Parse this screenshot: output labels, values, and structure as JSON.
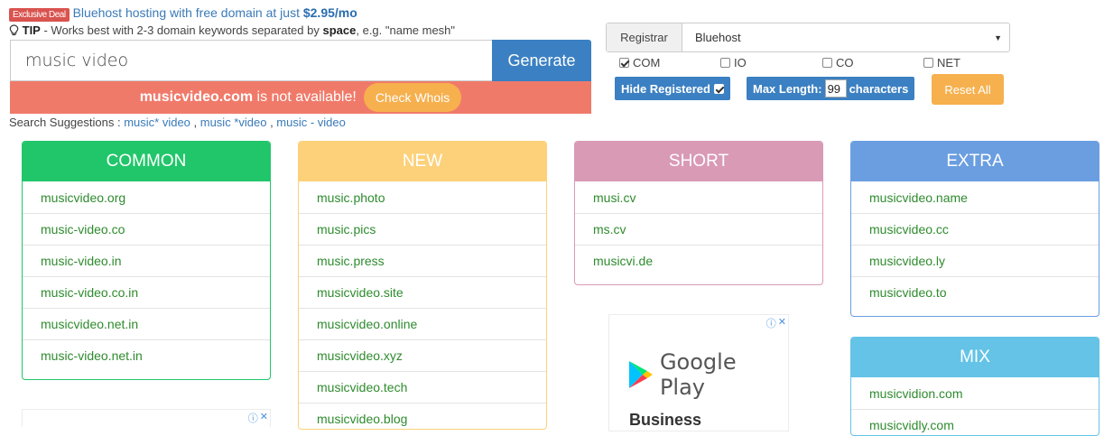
{
  "promo": {
    "badge": "Exclusive Deal",
    "text": "Bluehost hosting with free domain at just ",
    "price": "$2.95/mo"
  },
  "tip": {
    "label": "TIP",
    "text_before": " - Works best with 2-3 domain keywords separated by ",
    "bold": "space",
    "text_after": ", e.g. \"name mesh\""
  },
  "search": {
    "value": "music video",
    "button": "Generate"
  },
  "availability": {
    "domain": "musicvideo.com",
    "message": " is not available!",
    "button": "Check Whois"
  },
  "suggestions": {
    "label": "Search Suggestions : ",
    "items": [
      "music* video",
      "music *video",
      "music - video"
    ]
  },
  "filters": {
    "registrar_label": "Registrar",
    "registrar_value": "Bluehost",
    "tlds": [
      {
        "label": "COM",
        "checked": true
      },
      {
        "label": "IO",
        "checked": false
      },
      {
        "label": "CO",
        "checked": false
      },
      {
        "label": "NET",
        "checked": false
      }
    ],
    "hide_registered": "Hide Registered",
    "max_length_label": "Max Length:",
    "max_length_value": "99",
    "max_length_unit": "characters",
    "reset": "Reset All"
  },
  "cards": {
    "common": {
      "title": "COMMON",
      "items": [
        "musicvideo.org",
        "music-video.co",
        "music-video.in",
        "music-video.co.in",
        "musicvideo.net.in",
        "music-video.net.in"
      ]
    },
    "new": {
      "title": "NEW",
      "items": [
        "music.photo",
        "music.pics",
        "music.press",
        "musicvideo.site",
        "musicvideo.online",
        "musicvideo.xyz",
        "musicvideo.tech",
        "musicvideo.blog"
      ]
    },
    "short": {
      "title": "SHORT",
      "items": [
        "musi.cv",
        "ms.cv",
        "musicvi.de"
      ]
    },
    "extra": {
      "title": "EXTRA",
      "items": [
        "musicvideo.name",
        "musicvideo.cc",
        "musicvideo.ly",
        "musicvideo.to"
      ]
    },
    "mix": {
      "title": "MIX",
      "items": [
        "musicvidion.com",
        "musicvidly.com"
      ]
    }
  },
  "ad": {
    "brand": "Google Play",
    "headline": "Business"
  },
  "colors": {
    "common": "#21c66a",
    "new": "#fcd17a",
    "short": "#d99ab6",
    "extra": "#6a9ee0",
    "mix": "#64c3e6",
    "primary": "#3b80c2",
    "alert": "#f07a6a",
    "accent": "#f6b04e"
  }
}
